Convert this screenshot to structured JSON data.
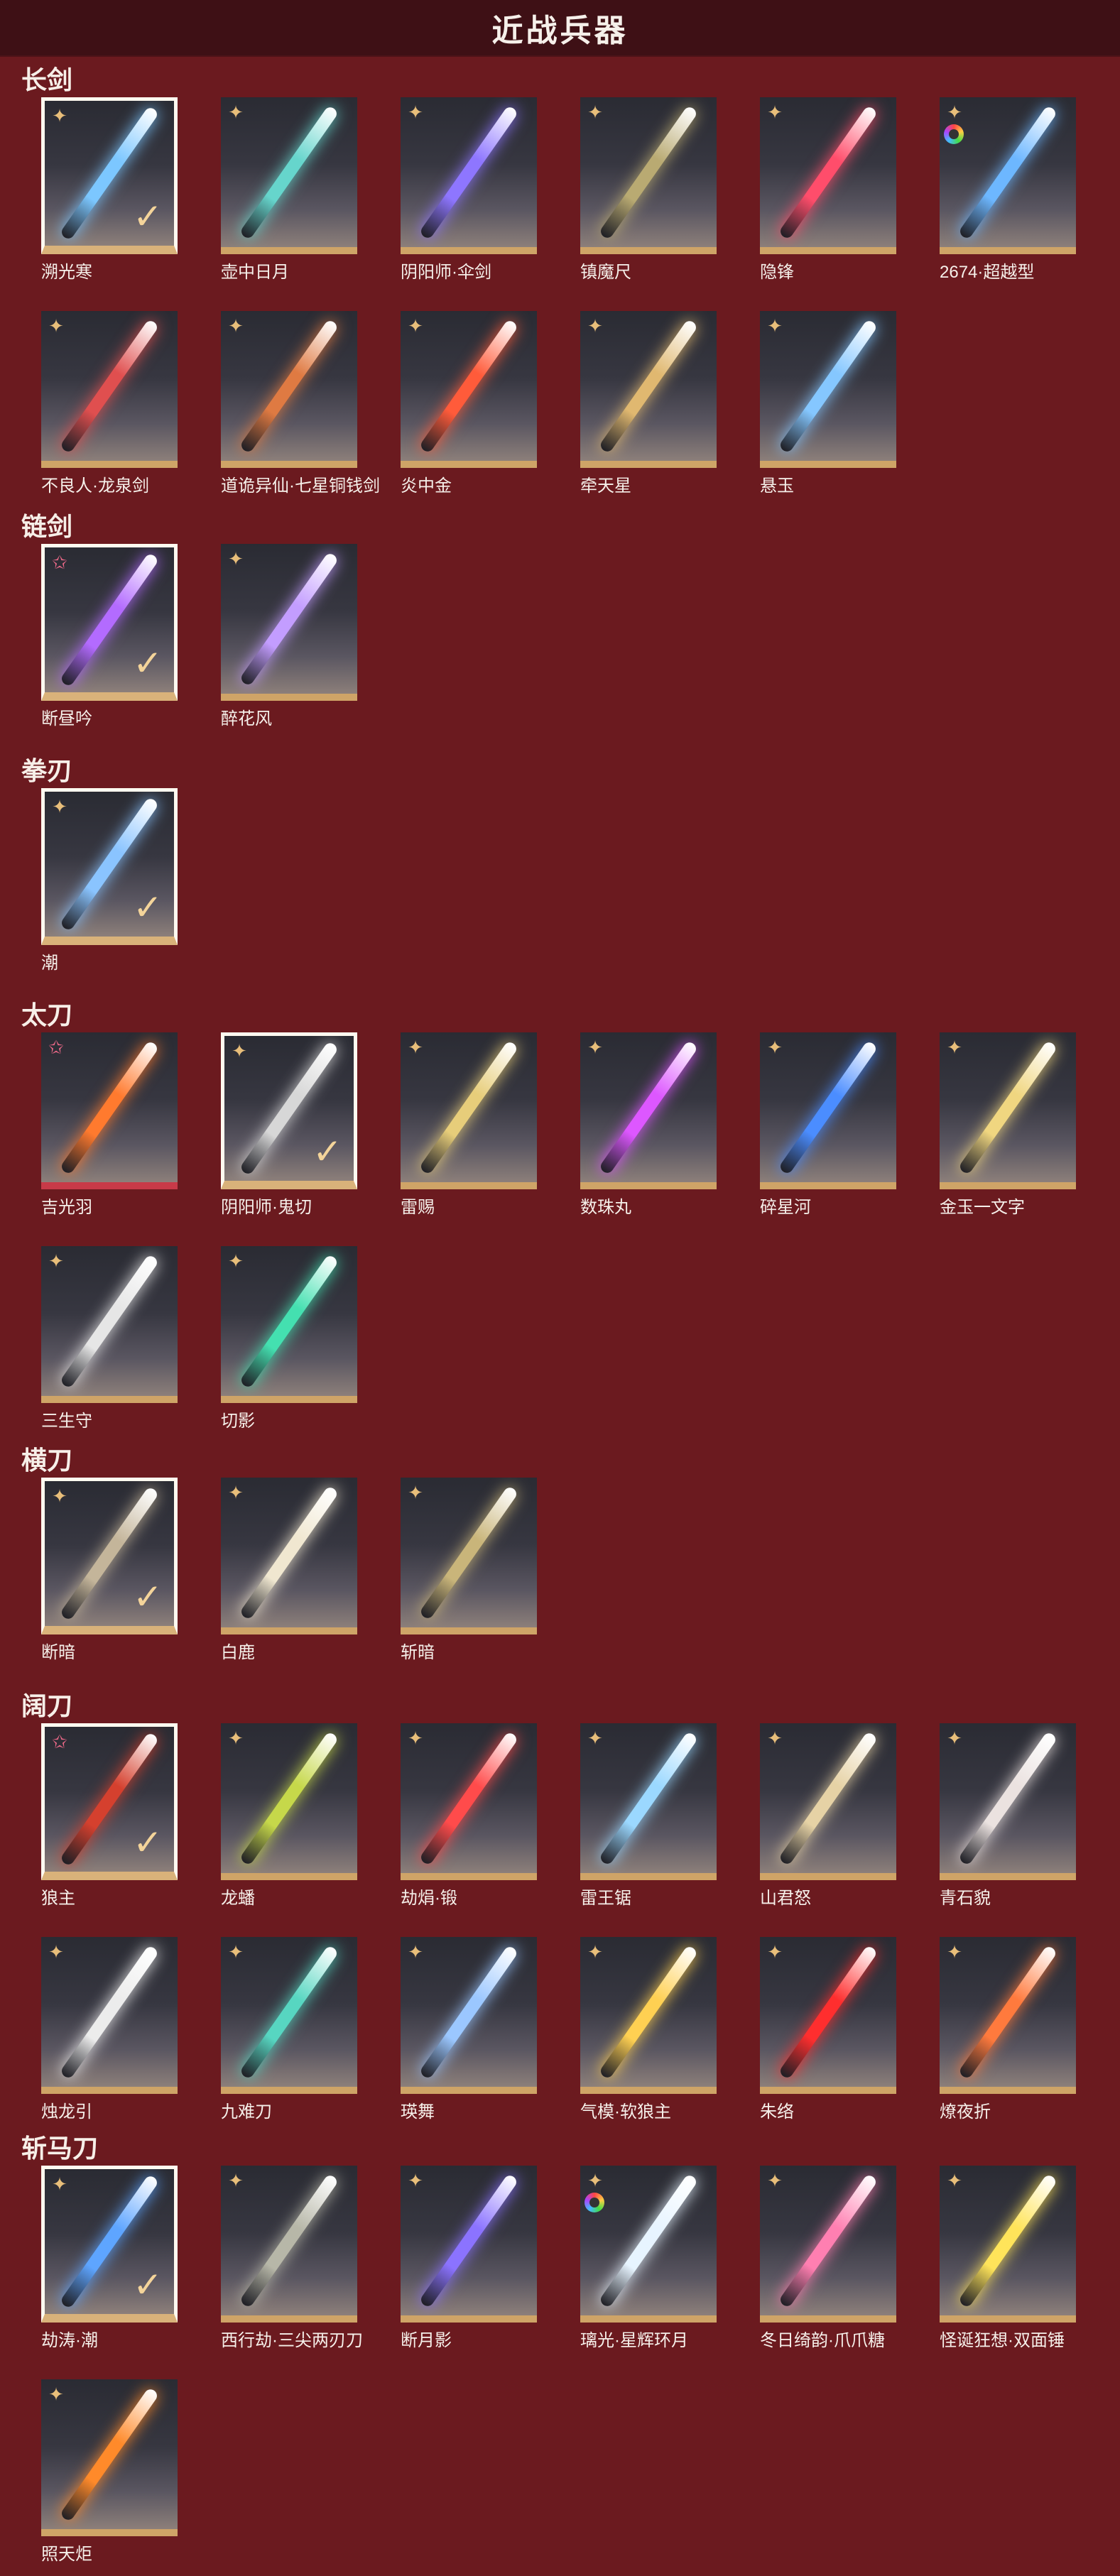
{
  "header": {
    "title": "近战兵器"
  },
  "sections": [
    {
      "title": "长剑",
      "items": [
        {
          "name": "溯光寒",
          "badge": "diamond",
          "selected": true,
          "color": "#7cc7ff"
        },
        {
          "name": "壶中日月",
          "badge": "diamond",
          "selected": false,
          "color": "#66d5cc"
        },
        {
          "name": "阴阳师·伞剑",
          "badge": "diamond",
          "selected": false,
          "color": "#8e76ff"
        },
        {
          "name": "镇魔尺",
          "badge": "diamond",
          "selected": false,
          "color": "#b9aa72"
        },
        {
          "name": "隐锋",
          "badge": "diamond",
          "selected": false,
          "color": "#ff4d6b"
        },
        {
          "name": "2674·超越型",
          "badge": "ring",
          "selected": false,
          "color": "#6db7ff"
        },
        {
          "name": "不良人·龙泉剑",
          "badge": "diamond",
          "selected": false,
          "color": "#e04f4f"
        },
        {
          "name": "道诡异仙·七星铜钱剑",
          "badge": "diamond",
          "selected": false,
          "color": "#df7a42"
        },
        {
          "name": "炎中金",
          "badge": "diamond",
          "selected": false,
          "color": "#ff5b3a"
        },
        {
          "name": "牵天星",
          "badge": "diamond",
          "selected": false,
          "color": "#e0b870"
        },
        {
          "name": "悬玉",
          "badge": "diamond",
          "selected": false,
          "color": "#85c7ff"
        }
      ]
    },
    {
      "title": "链剑",
      "items": [
        {
          "name": "断昼吟",
          "badge": "star",
          "selected": true,
          "color": "#b36bff"
        },
        {
          "name": "醉花风",
          "badge": "diamond",
          "selected": false,
          "color": "#c39dff"
        }
      ]
    },
    {
      "title": "拳刃",
      "items": [
        {
          "name": "潮",
          "badge": "diamond",
          "selected": true,
          "color": "#8ac4ff"
        }
      ]
    },
    {
      "title": "太刀",
      "items": [
        {
          "name": "吉光羽",
          "badge": "star",
          "selected": false,
          "color": "#ff7a2e",
          "pink": true
        },
        {
          "name": "阴阳师·鬼切",
          "badge": "diamond",
          "selected": true,
          "color": "#d7d7d7"
        },
        {
          "name": "雷赐",
          "badge": "diamond",
          "selected": false,
          "color": "#e7cd7a"
        },
        {
          "name": "数珠丸",
          "badge": "diamond",
          "selected": false,
          "color": "#dd57ff"
        },
        {
          "name": "碎星河",
          "badge": "diamond",
          "selected": false,
          "color": "#4b8dff"
        },
        {
          "name": "金玉一文字",
          "badge": "diamond",
          "selected": false,
          "color": "#f0d680"
        },
        {
          "name": "三生守",
          "badge": "diamond",
          "selected": false,
          "color": "#e6e6e6"
        },
        {
          "name": "切影",
          "badge": "diamond",
          "selected": false,
          "color": "#44e0b0"
        }
      ]
    },
    {
      "title": "横刀",
      "items": [
        {
          "name": "断暗",
          "badge": "diamond",
          "selected": true,
          "color": "#c4b59a"
        },
        {
          "name": "白鹿",
          "badge": "diamond",
          "selected": false,
          "color": "#f0e7d0"
        },
        {
          "name": "斩暗",
          "badge": "diamond",
          "selected": false,
          "color": "#c9b57a"
        }
      ]
    },
    {
      "title": "阔刀",
      "items": [
        {
          "name": "狼主",
          "badge": "star",
          "selected": true,
          "color": "#d5402e"
        },
        {
          "name": "龙蟠",
          "badge": "diamond",
          "selected": false,
          "color": "#c6d84a"
        },
        {
          "name": "劫焆·锻",
          "badge": "diamond",
          "selected": false,
          "color": "#ff4b4b"
        },
        {
          "name": "雷王锯",
          "badge": "diamond",
          "selected": false,
          "color": "#9bd8ff"
        },
        {
          "name": "山君怒",
          "badge": "diamond",
          "selected": false,
          "color": "#e6d2a5"
        },
        {
          "name": "青石貌",
          "badge": "diamond",
          "selected": false,
          "color": "#ebe2e0"
        },
        {
          "name": "烛龙引",
          "badge": "diamond",
          "selected": false,
          "color": "#ececec"
        },
        {
          "name": "九难刀",
          "badge": "diamond",
          "selected": false,
          "color": "#57d6c1"
        },
        {
          "name": "瑛舞",
          "badge": "diamond",
          "selected": false,
          "color": "#9bc7ff"
        },
        {
          "name": "气模·软狼主",
          "badge": "diamond",
          "selected": false,
          "color": "#ffd052"
        },
        {
          "name": "朱络",
          "badge": "diamond",
          "selected": false,
          "color": "#ff2e2e"
        },
        {
          "name": "燎夜折",
          "badge": "diamond",
          "selected": false,
          "color": "#ff7a3d"
        }
      ]
    },
    {
      "title": "斩马刀",
      "items": [
        {
          "name": "劫涛·潮",
          "badge": "diamond",
          "selected": true,
          "color": "#5ea5ff"
        },
        {
          "name": "西行劫·三尖两刃刀",
          "badge": "diamond",
          "selected": false,
          "color": "#b7b7a8"
        },
        {
          "name": "断月影",
          "badge": "diamond",
          "selected": false,
          "color": "#8b73ff"
        },
        {
          "name": "璃光·星辉环月",
          "badge": "ring",
          "selected": false,
          "color": "#e7f4ff"
        },
        {
          "name": "冬日绮韵·爪爪糖",
          "badge": "diamond",
          "selected": false,
          "color": "#ff7fb1"
        },
        {
          "name": "怪诞狂想·双面锤",
          "badge": "diamond",
          "selected": false,
          "color": "#ffe45a"
        },
        {
          "name": "照天炬",
          "badge": "diamond",
          "selected": false,
          "color": "#ff8a2a"
        }
      ]
    }
  ]
}
